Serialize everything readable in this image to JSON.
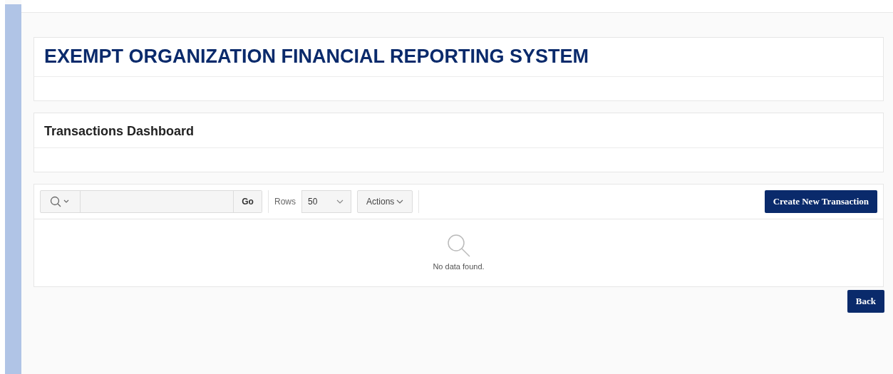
{
  "header": {
    "title": "EXEMPT ORGANIZATION FINANCIAL REPORTING SYSTEM"
  },
  "dashboard": {
    "title": "Transactions Dashboard"
  },
  "report": {
    "go_button": "Go",
    "rows_label": "Rows",
    "rows_value": "50",
    "actions_button": "Actions",
    "create_button": "Create New Transaction",
    "empty_message": "No data found."
  },
  "back_button": "Back"
}
